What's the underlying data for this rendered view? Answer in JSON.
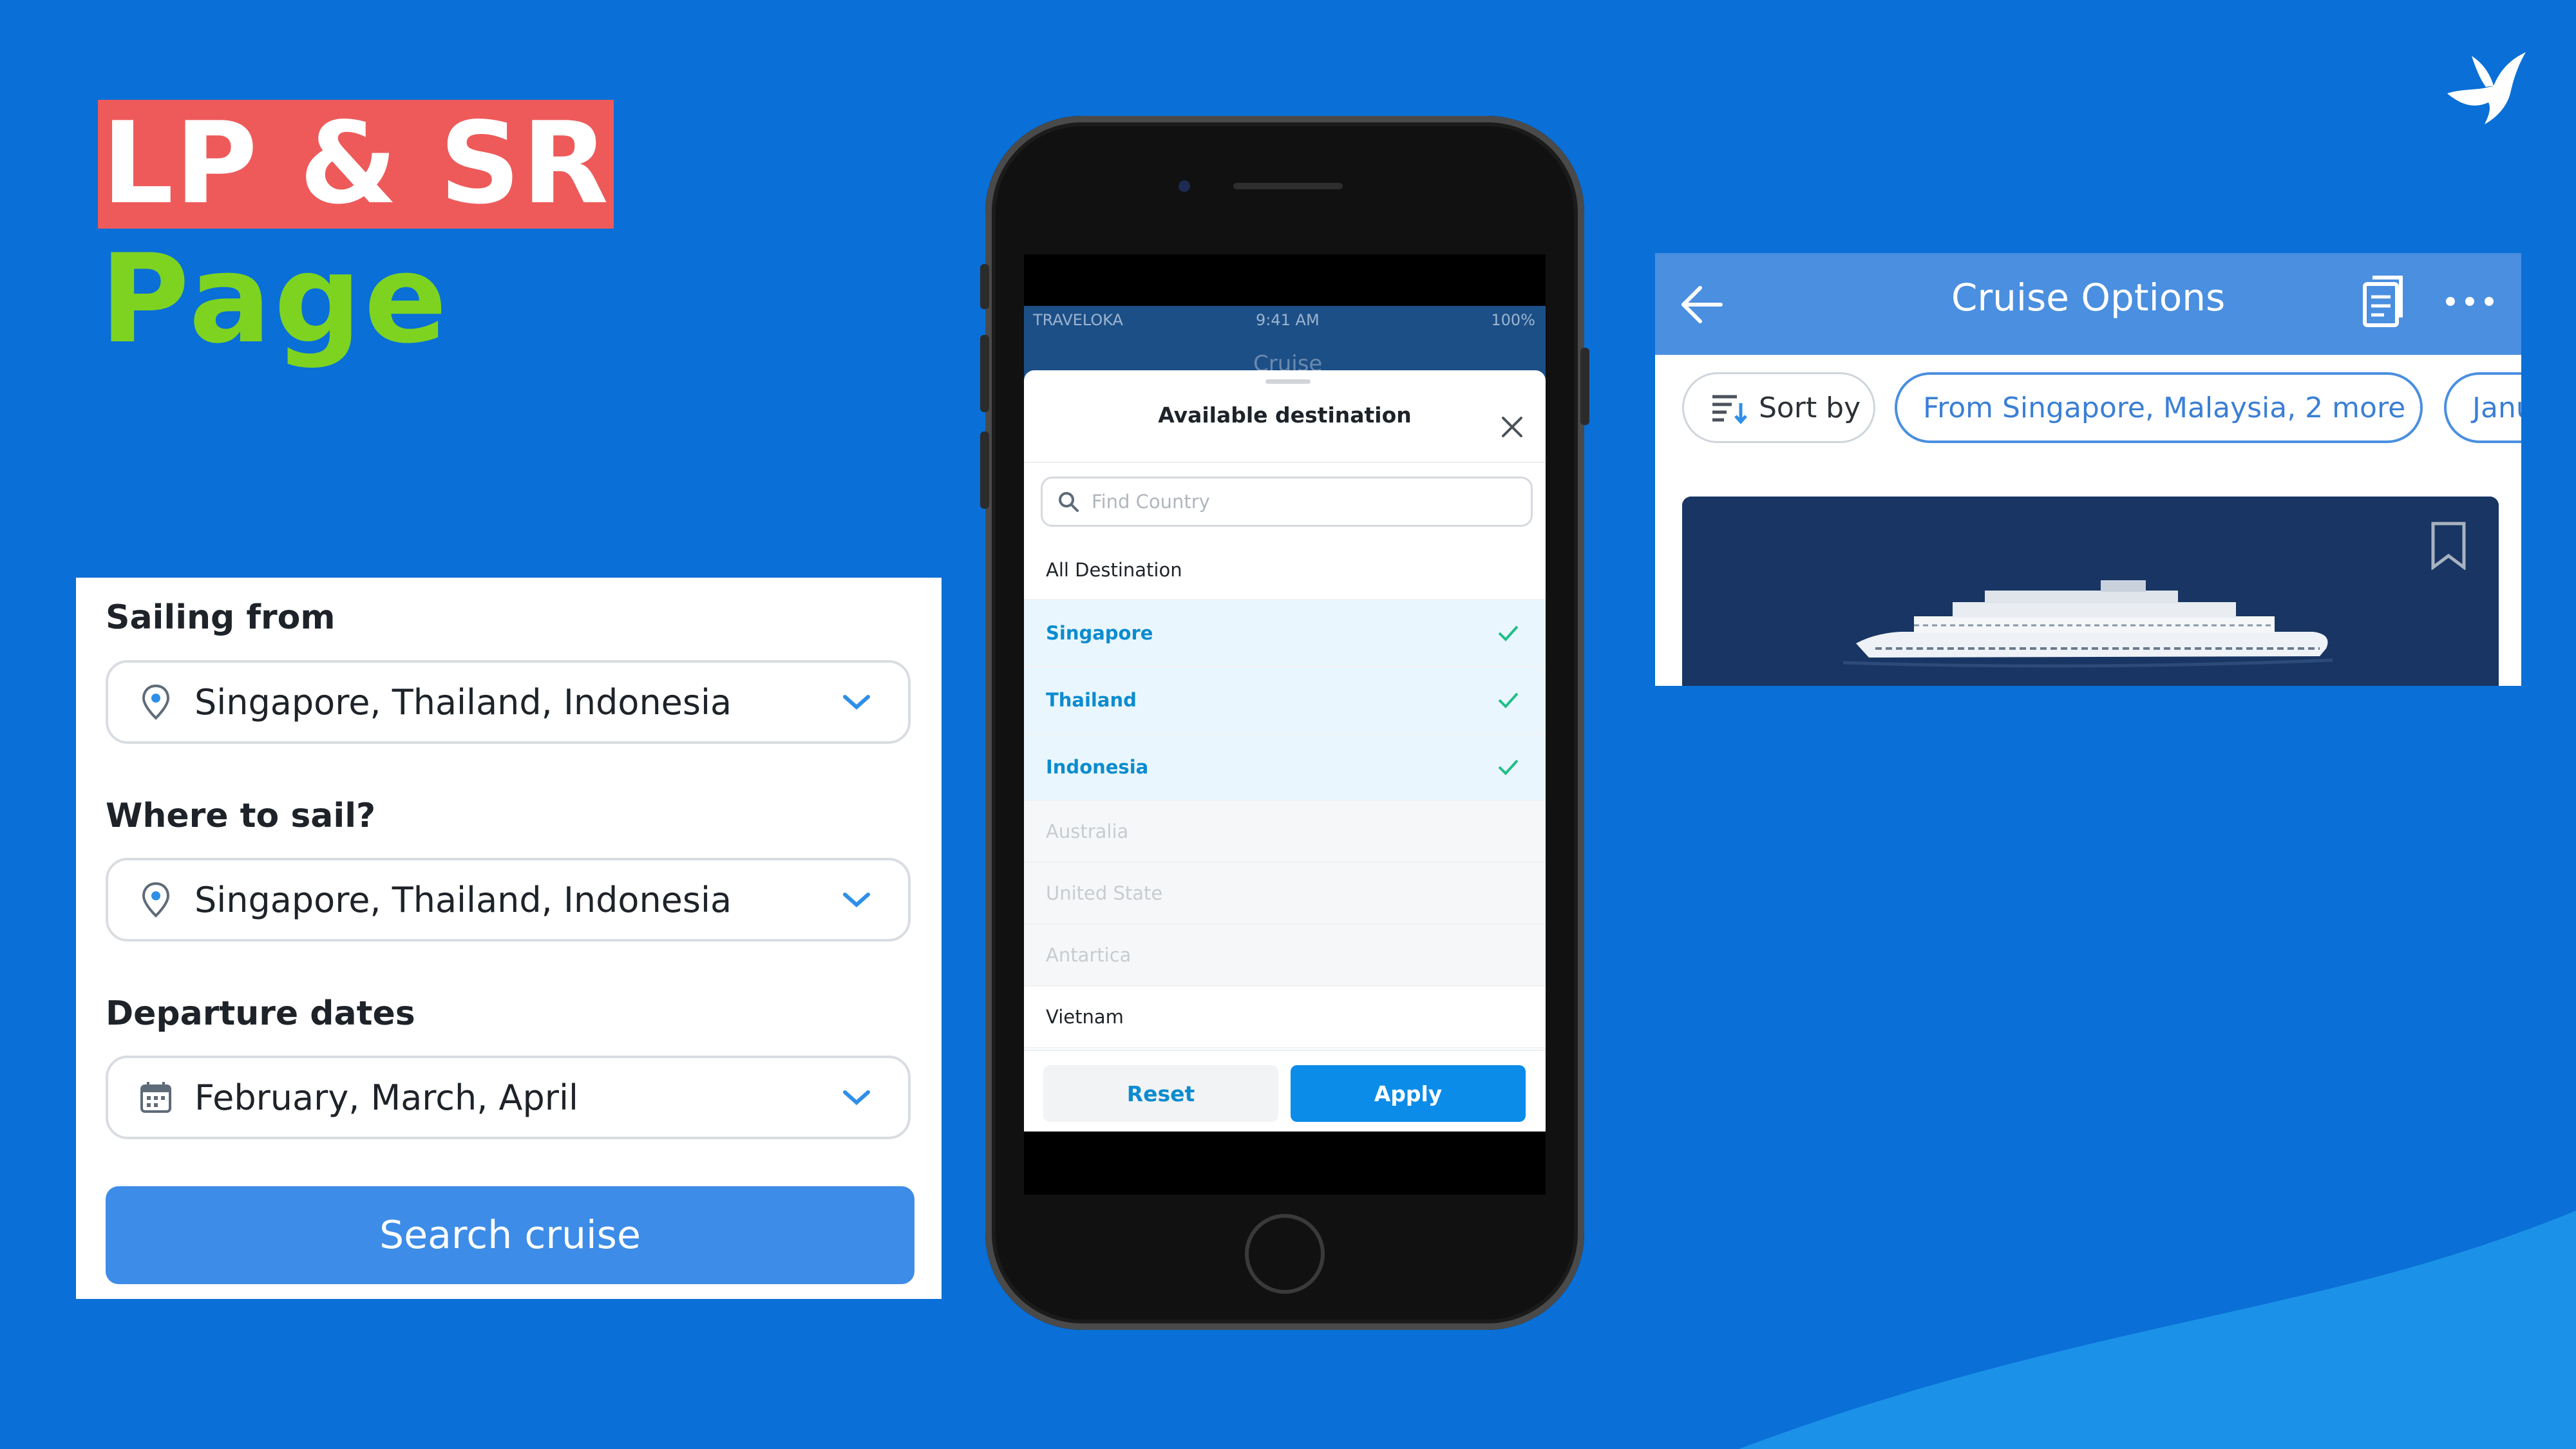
{
  "slide": {
    "title_line1": "LP & SR",
    "title_line2": "Page",
    "colors": {
      "background": "#0a6fd6",
      "title_highlight": "#ee5a5a",
      "title_accent": "#7ed321"
    }
  },
  "search_form": {
    "sailing_from_label": "Sailing from",
    "sailing_from_value": "Singapore, Thailand, Indonesia",
    "where_to_sail_label": "Where to sail?",
    "where_to_sail_value": "Singapore, Thailand, Indonesia",
    "departure_dates_label": "Departure dates",
    "departure_dates_value": "February, March, April",
    "search_button": "Search cruise",
    "icons": {
      "location": "location-pin-icon",
      "calendar": "calendar-icon",
      "dropdown": "chevron-down-icon"
    }
  },
  "phone": {
    "status_bar": {
      "carrier": "TRAVELOKA",
      "time": "9:41 AM",
      "battery": "100%"
    },
    "nav_title": "Cruise",
    "sheet": {
      "title": "Available destination",
      "search_placeholder": "Find Country",
      "destinations": [
        {
          "label": "All Destination",
          "state": "all"
        },
        {
          "label": "Singapore",
          "state": "selected"
        },
        {
          "label": "Thailand",
          "state": "selected"
        },
        {
          "label": "Indonesia",
          "state": "selected"
        },
        {
          "label": "Australia",
          "state": "disabled"
        },
        {
          "label": "United State",
          "state": "disabled"
        },
        {
          "label": "Antartica",
          "state": "disabled"
        },
        {
          "label": "Vietnam",
          "state": "normal"
        }
      ],
      "reset_button": "Reset",
      "apply_button": "Apply"
    }
  },
  "cruise_options": {
    "title": "Cruise Options",
    "sort_chip": "Sort by",
    "from_chip": "From Singapore, Malaysia, 2 more",
    "date_chip": "Janu",
    "icons": {
      "back": "arrow-left-icon",
      "saved": "saved-list-icon",
      "more": "more-dots-icon",
      "bookmark": "bookmark-icon"
    }
  }
}
